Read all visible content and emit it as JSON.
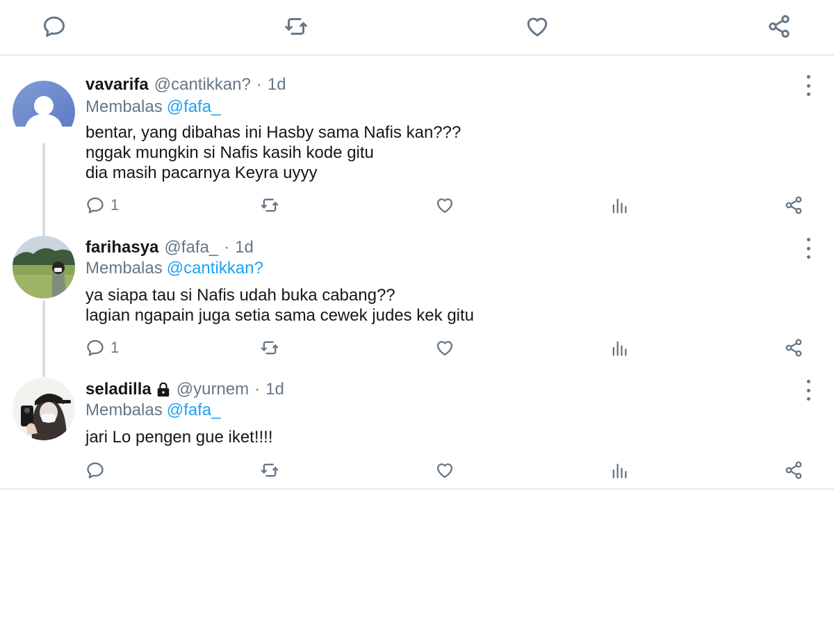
{
  "icons": {
    "reply": "reply-icon",
    "retweet": "retweet-icon",
    "like": "heart-icon",
    "views": "analytics-icon",
    "share": "share-icon",
    "more": "more-vertical-icon",
    "lock": "lock-icon"
  },
  "colors": {
    "text": "#14171a",
    "muted": "#657786",
    "link": "#1da1f2",
    "border": "#e6ecf0"
  },
  "tweets": [
    {
      "name": "vavarifa",
      "handle": "@cantikkan?",
      "separator": "·",
      "time": "1d",
      "reply_label": "Membalas",
      "reply_to": "@fafa_",
      "lines": [
        "bentar, yang dibahas ini Hasby sama Nafis kan???",
        "nggak mungkin si Nafis kasih kode gitu",
        "dia masih pacarnya Keyra uyyy"
      ],
      "reply_count": "1"
    },
    {
      "name": "farihasya",
      "handle": "@fafa_",
      "separator": "·",
      "time": "1d",
      "reply_label": "Membalas",
      "reply_to": "@cantikkan?",
      "lines": [
        "ya siapa tau si Nafis udah buka cabang??",
        "lagian ngapain juga setia sama cewek judes kek gitu"
      ],
      "reply_count": "1"
    },
    {
      "name": "seladilla",
      "handle": "@yurnem",
      "separator": "·",
      "time": "1d",
      "reply_label": "Membalas",
      "reply_to": "@fafa_",
      "lines": [
        "jari Lo pengen gue iket!!!!"
      ],
      "reply_count": ""
    }
  ]
}
